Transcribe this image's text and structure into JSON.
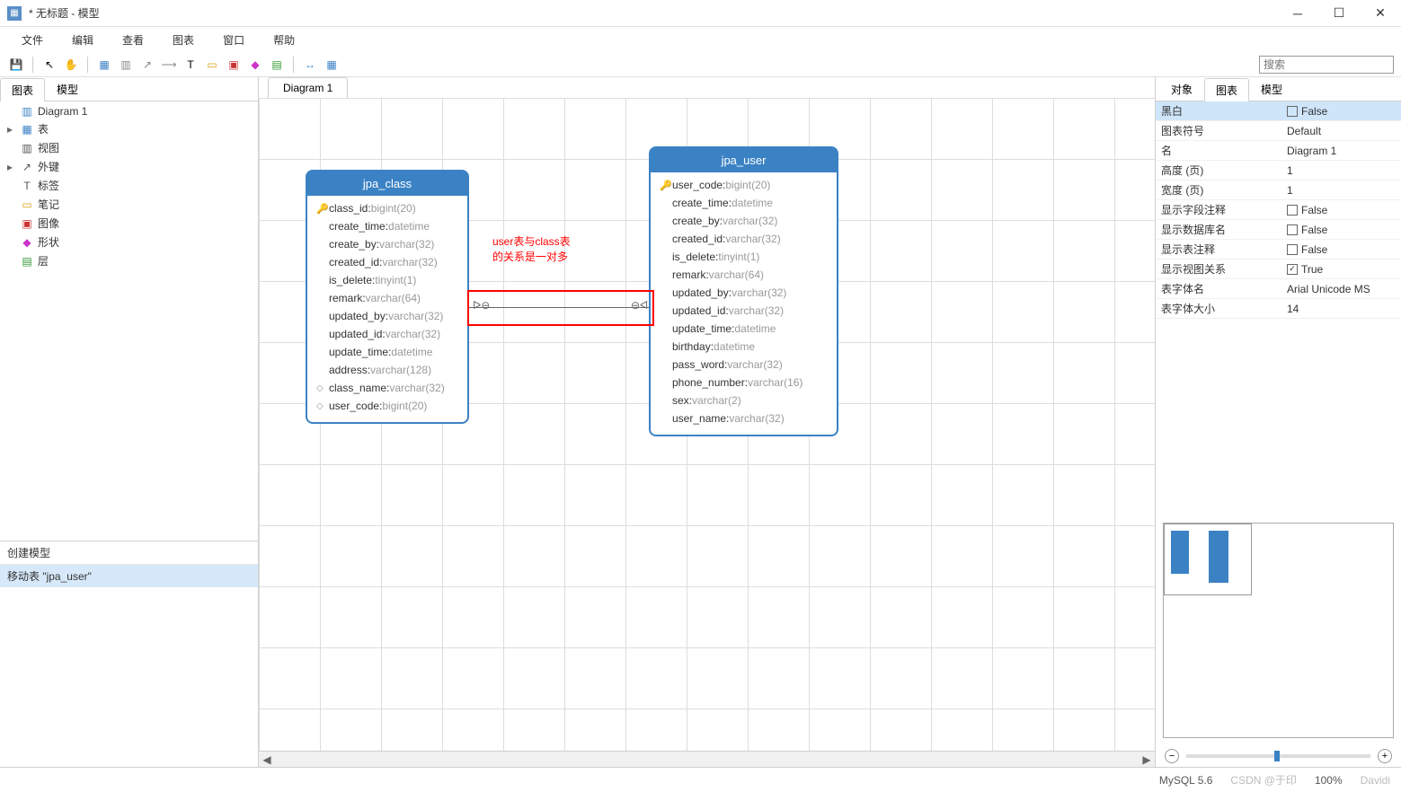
{
  "window": {
    "title": "* 无标题 - 模型"
  },
  "menu": {
    "file": "文件",
    "edit": "编辑",
    "view": "查看",
    "diagram": "图表",
    "window": "窗口",
    "help": "帮助"
  },
  "search": {
    "placeholder": "搜索"
  },
  "left_tabs": {
    "diagram": "图表",
    "model": "模型"
  },
  "tree": {
    "diagram1": "Diagram 1",
    "table": "表",
    "view": "视图",
    "fk": "外键",
    "tag": "标签",
    "note": "笔记",
    "image": "图像",
    "shape": "形状",
    "layer": "层"
  },
  "history": {
    "header": "创建模型",
    "item1": "移动表 \"jpa_user\""
  },
  "canvas_tab": "Diagram 1",
  "annotation": {
    "line1": "user表与class表",
    "line2": "的关系是一对多"
  },
  "entities": {
    "class": {
      "title": "jpa_class",
      "cols": [
        {
          "key": true,
          "name": "class_id",
          "type": "bigint(20)"
        },
        {
          "name": "create_time",
          "type": "datetime"
        },
        {
          "name": "create_by",
          "type": "varchar(32)"
        },
        {
          "name": "created_id",
          "type": "varchar(32)"
        },
        {
          "name": "is_delete",
          "type": "tinyint(1)"
        },
        {
          "name": "remark",
          "type": "varchar(64)"
        },
        {
          "name": "updated_by",
          "type": "varchar(32)"
        },
        {
          "name": "updated_id",
          "type": "varchar(32)"
        },
        {
          "name": "update_time",
          "type": "datetime"
        },
        {
          "name": "address",
          "type": "varchar(128)"
        },
        {
          "dia": true,
          "name": "class_name",
          "type": "varchar(32)"
        },
        {
          "dia": true,
          "name": "user_code",
          "type": "bigint(20)"
        }
      ]
    },
    "user": {
      "title": "jpa_user",
      "cols": [
        {
          "key": true,
          "name": "user_code",
          "type": "bigint(20)"
        },
        {
          "name": "create_time",
          "type": "datetime"
        },
        {
          "name": "create_by",
          "type": "varchar(32)"
        },
        {
          "name": "created_id",
          "type": "varchar(32)"
        },
        {
          "name": "is_delete",
          "type": "tinyint(1)"
        },
        {
          "name": "remark",
          "type": "varchar(64)"
        },
        {
          "name": "updated_by",
          "type": "varchar(32)"
        },
        {
          "name": "updated_id",
          "type": "varchar(32)"
        },
        {
          "name": "update_time",
          "type": "datetime"
        },
        {
          "name": "birthday",
          "type": "datetime"
        },
        {
          "name": "pass_word",
          "type": "varchar(32)"
        },
        {
          "name": "phone_number",
          "type": "varchar(16)"
        },
        {
          "name": "sex",
          "type": "varchar(2)"
        },
        {
          "name": "user_name",
          "type": "varchar(32)"
        }
      ]
    }
  },
  "right_tabs": {
    "object": "对象",
    "diagram": "图表",
    "model": "模型"
  },
  "props": [
    {
      "name": "黑白",
      "type": "check",
      "value": "False",
      "checked": false,
      "sel": true
    },
    {
      "name": "图表符号",
      "type": "text",
      "value": "Default"
    },
    {
      "name": "名",
      "type": "text",
      "value": "Diagram 1"
    },
    {
      "name": "高度 (页)",
      "type": "text",
      "value": "1"
    },
    {
      "name": "宽度 (页)",
      "type": "text",
      "value": "1"
    },
    {
      "name": "显示字段注释",
      "type": "check",
      "value": "False",
      "checked": false
    },
    {
      "name": "显示数据库名",
      "type": "check",
      "value": "False",
      "checked": false
    },
    {
      "name": "显示表注释",
      "type": "check",
      "value": "False",
      "checked": false
    },
    {
      "name": "显示视图关系",
      "type": "check",
      "value": "True",
      "checked": true
    },
    {
      "name": "表字体名",
      "type": "text",
      "value": "Arial Unicode MS"
    },
    {
      "name": "表字体大小",
      "type": "text",
      "value": "14"
    }
  ],
  "status": {
    "db": "MySQL 5.6",
    "zoom": "100%",
    "watermark1": "CSDN @于印",
    "watermark2": "Davidi"
  }
}
